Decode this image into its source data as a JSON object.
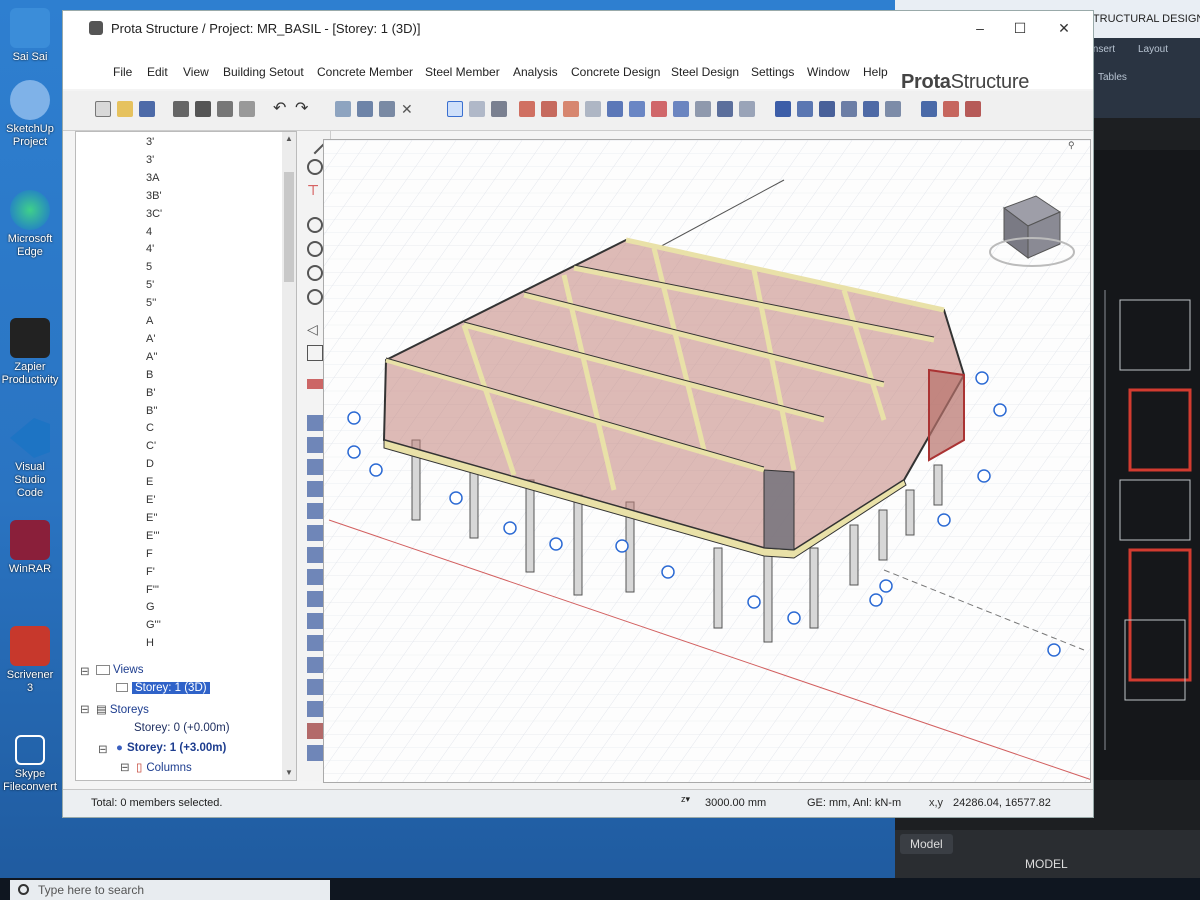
{
  "desktop": {
    "icons": [
      {
        "label": "Sai Sai"
      },
      {
        "label": "SketchUp\nProject"
      },
      {
        "label": "Microsoft\nEdge"
      },
      {
        "label": "Zapier\nProductivity"
      },
      {
        "label": "Visual Studio\nCode"
      },
      {
        "label": "WinRAR"
      },
      {
        "label": "Scrivener\n3"
      },
      {
        "label": "Skype\nFileconvert"
      }
    ],
    "taskbar_search": "Type here to search"
  },
  "cad_window": {
    "title": "STONEBRIDGE COMPANY STRUCTURAL DESIGN",
    "ribbon_tabs": [
      "Insert",
      "Layout",
      "Tables"
    ],
    "bottom_tabs": [
      "Model",
      "MODEL"
    ]
  },
  "app": {
    "title": "Prota Structure / Project: MR_BASIL - [Storey: 1 (3D)]",
    "menu": [
      "File",
      "Edit",
      "View",
      "Building Setout",
      "Concrete Member",
      "Steel Member",
      "Analysis",
      "Concrete Design",
      "Steel Design",
      "Settings",
      "Window",
      "Help"
    ],
    "brand_bold": "Prota",
    "brand_rest": "Structure",
    "window_controls": {
      "min": "–",
      "max": "☐",
      "close": "✕"
    }
  },
  "tree": {
    "axes": [
      "3'",
      "3'",
      "3A",
      "3B'",
      "3C'",
      "4",
      "4'",
      "5",
      "5'",
      "5''",
      "A",
      "A'",
      "A''",
      "B",
      "B'",
      "B''",
      "C",
      "C'",
      "D",
      "E",
      "E'",
      "E''",
      "E'''",
      "F",
      "F'",
      "F'''",
      "G",
      "G'''",
      "H"
    ],
    "views_label": "Views",
    "view_item": "Storey: 1 (3D)",
    "storeys_label": "Storeys",
    "storey0": "Storey: 0 (+0.00m)",
    "storey1": "Storey: 1 (+3.00m)",
    "columns_label": "Columns"
  },
  "status": {
    "selection": "Total: 0 members selected.",
    "elevation": "3000.00 mm",
    "units": "GE: mm,  Anl: kN-m",
    "coords_label": "x,y",
    "coords": "24286.04, 16577.82"
  },
  "colors": {
    "beam": "#e9e1a8",
    "wall_fill": "#b7706a",
    "grid": "#dfe3ea",
    "axis_bubble": "#2d6bd4"
  }
}
